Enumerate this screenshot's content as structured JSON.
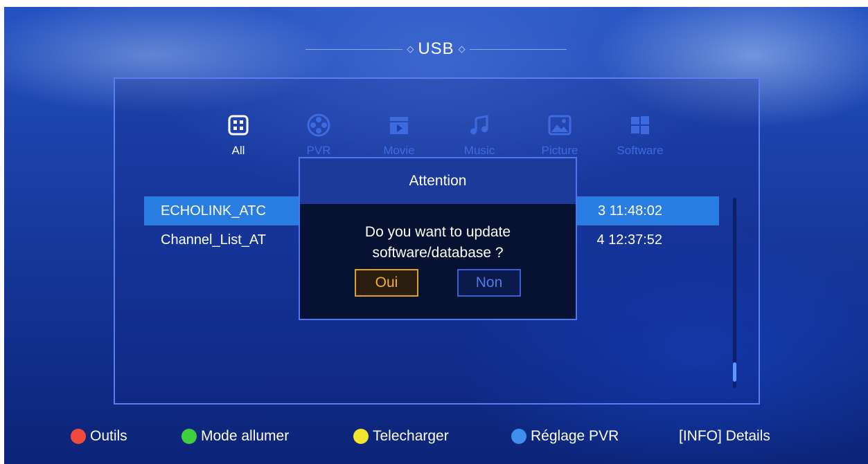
{
  "header": {
    "title": "USB",
    "deco_left": "◇",
    "deco_right": "◇"
  },
  "categories": [
    {
      "label": "All",
      "icon": "grid-icon",
      "active": true
    },
    {
      "label": "PVR",
      "icon": "film-reel-icon",
      "active": false
    },
    {
      "label": "Movie",
      "icon": "clapperboard-icon",
      "active": false
    },
    {
      "label": "Music",
      "icon": "music-note-icon",
      "active": false
    },
    {
      "label": "Picture",
      "icon": "picture-icon",
      "active": false
    },
    {
      "label": "Software",
      "icon": "windows-icon",
      "active": false
    }
  ],
  "files": [
    {
      "name": "ECHOLINK_ATC",
      "date": "3 11:48:02",
      "selected": true
    },
    {
      "name": "Channel_List_AT",
      "date": "4 12:37:52",
      "selected": false
    }
  ],
  "dialog": {
    "title": "Attention",
    "message_line1": "Do you want to update",
    "message_line2": "software/database ?",
    "yes_label": "Oui",
    "no_label": "Non"
  },
  "footer": {
    "red_label": "Outils",
    "green_label": "Mode allumer",
    "yellow_label": "Telecharger",
    "blue_label": "Réglage PVR",
    "info_label": "[INFO] Details"
  },
  "colors": {
    "red": "#f04a3c",
    "green": "#3fcf3f",
    "yellow": "#f2e530",
    "blue": "#3f8fef",
    "selection": "#2a7de0",
    "accent_orange": "#f3b22a"
  }
}
